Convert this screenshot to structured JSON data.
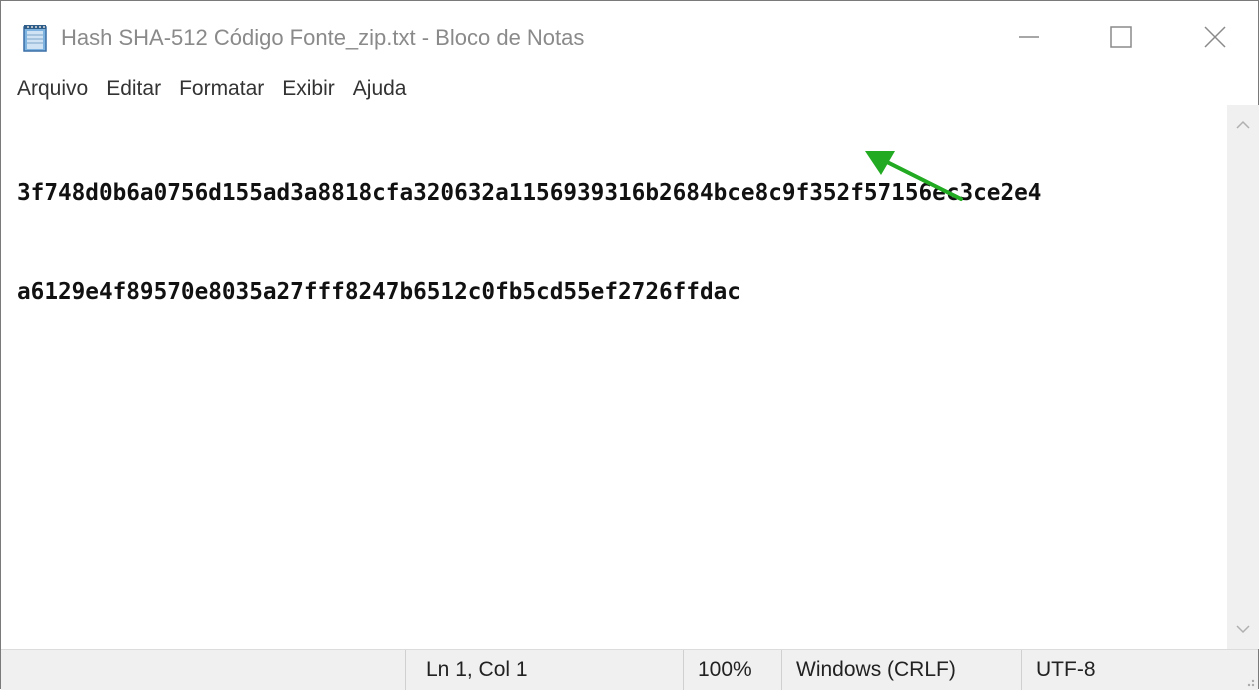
{
  "window": {
    "title": "Hash SHA-512 Código Fonte_zip.txt - Bloco de Notas",
    "icon": "notepad-icon"
  },
  "controls": {
    "minimize_icon": "minimize-icon",
    "maximize_icon": "maximize-icon",
    "close_icon": "close-icon"
  },
  "menu": {
    "items": [
      {
        "label": "Arquivo"
      },
      {
        "label": "Editar"
      },
      {
        "label": "Formatar"
      },
      {
        "label": "Exibir"
      },
      {
        "label": "Ajuda"
      }
    ]
  },
  "editor": {
    "lines": [
      "3f748d0b6a0756d155ad3a8818cfa320632a1156939316b2684bce8c9f352f57156ec3ce2e4",
      "a6129e4f89570e8035a27fff8247b6512c0fb5cd55ef2726ffdac"
    ]
  },
  "statusbar": {
    "position": "Ln 1, Col 1",
    "zoom": "100%",
    "line_ending": "Windows (CRLF)",
    "encoding": "UTF-8"
  },
  "annotation": {
    "arrow_color": "#22aa22",
    "icon": "green-arrow-icon"
  }
}
